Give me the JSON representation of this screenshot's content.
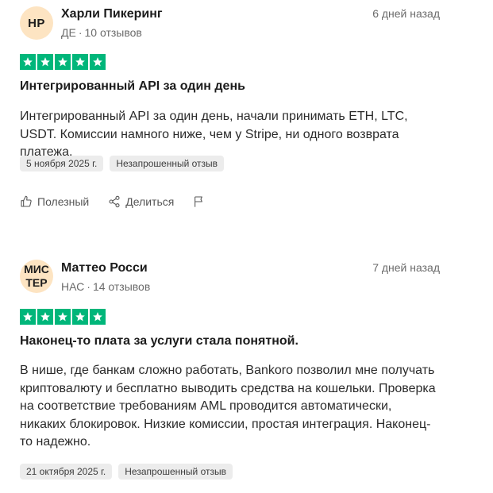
{
  "colors": {
    "star_green": "#00b67a",
    "avatar_bg": "#fde4c2",
    "tag_bg": "#ececec"
  },
  "actions": {
    "helpful_label": "Полезный",
    "share_label": "Делиться",
    "flag_icon": "flag-icon"
  },
  "reviews": [
    {
      "initials": "HP",
      "name": "Харли Пикеринг",
      "country": "ДЕ",
      "review_count": "10 отзывов",
      "time_ago": "6 дней назад",
      "rating": 5,
      "title": "Интегрированный API за один день",
      "body": "Интегрированный API за один день, начали принимать ETH, LTC, USDT. Комиссии намного ниже, чем у Stripe, ни одного возврата платежа.",
      "date_tag": "5 ноября 2025 г.",
      "status_tag": "Незапрошенный отзыв"
    },
    {
      "initials": "МИС\nТЕР",
      "name": "Маттео Росси",
      "country": "НАС",
      "review_count": "14 отзывов",
      "time_ago": "7 дней назад",
      "rating": 5,
      "title": "Наконец-то плата за услуги стала понятной.",
      "body": "В нише, где банкам сложно работать, Bankoro позволил мне получать криптовалюту и бесплатно выводить средства на кошельки. Проверка на соответствие требованиям AML проводится автоматически, никаких блокировок. Низкие комиссии, простая интеграция. Наконец-то надежно.",
      "date_tag": "21 октября 2025 г.",
      "status_tag": "Незапрошенный отзыв"
    }
  ]
}
